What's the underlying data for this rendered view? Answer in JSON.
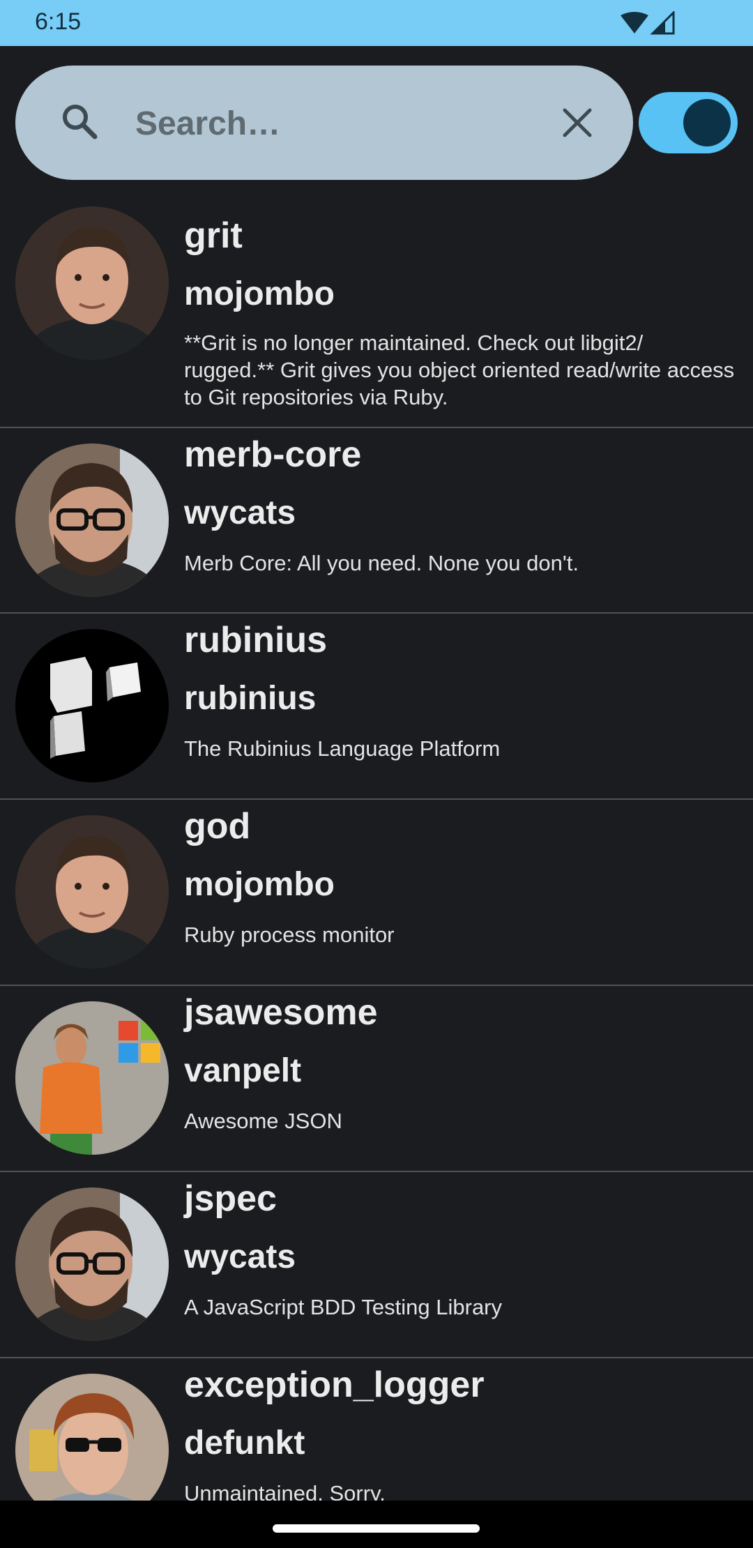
{
  "status_bar": {
    "time": "6:15",
    "wifi_icon": "wifi-icon",
    "signal_icon": "cell-signal-icon"
  },
  "search": {
    "placeholder": "Search…",
    "value": "",
    "search_icon": "search-icon",
    "clear_icon": "close-icon"
  },
  "toggle": {
    "state": "on"
  },
  "colors": {
    "status_bar": "#78cdf7",
    "background": "#1a1c1f",
    "search_pill": "#b2c7d3",
    "toggle_track": "#58c2f4",
    "toggle_knob": "#0b3247"
  },
  "repos": [
    {
      "name": "grit",
      "owner": "mojombo",
      "description": "**Grit is no longer maintained. Check out libgit2/ rugged.** Grit gives you object oriented read/write access to Git repositories via Ruby.",
      "avatar": "mojombo-avatar"
    },
    {
      "name": "merb-core",
      "owner": "wycats",
      "description": "Merb Core: All you need. None you don't.",
      "avatar": "wycats-avatar"
    },
    {
      "name": "rubinius",
      "owner": "rubinius",
      "description": "The Rubinius Language Platform",
      "avatar": "rubinius-logo-avatar"
    },
    {
      "name": "god",
      "owner": "mojombo",
      "description": "Ruby process monitor",
      "avatar": "mojombo-avatar"
    },
    {
      "name": "jsawesome",
      "owner": "vanpelt",
      "description": "Awesome JSON",
      "avatar": "vanpelt-avatar"
    },
    {
      "name": "jspec",
      "owner": "wycats",
      "description": "A JavaScript BDD Testing Library",
      "avatar": "wycats-avatar"
    },
    {
      "name": "exception_logger",
      "owner": "defunkt",
      "description": "Unmaintained. Sorry.",
      "avatar": "defunkt-avatar"
    }
  ]
}
